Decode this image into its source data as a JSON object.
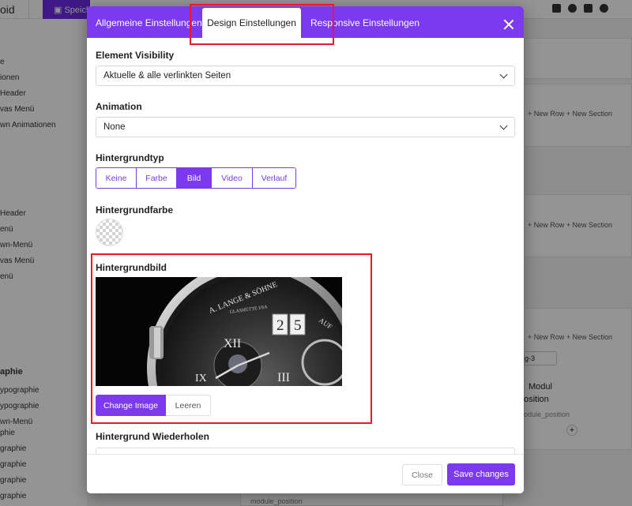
{
  "background": {
    "brand_fragment": "oid",
    "save_label": "Speichern",
    "sidebar_items": [
      "e",
      "ionen",
      "Header",
      "vas Menü",
      "wn Animationen",
      "Header",
      "enü",
      "wn-Menü",
      "vas Menü",
      "enü",
      "aphie",
      "ypographie",
      "ypographie",
      "wn-Menü",
      "phie",
      "graphie",
      "graphie",
      "graphie",
      "graphie"
    ],
    "row_control": "+ New Row  + New Section",
    "select_value": "g-3",
    "module_title": "Modul",
    "module_subtitle": "osition",
    "module_position": "odule_position",
    "bottom_text": "module_position",
    "plus": "+"
  },
  "modal": {
    "tabs": [
      "Allgemeine Einstellungen",
      "Design Einstellungen",
      "Responsive Einstellungen"
    ],
    "active_tab": "Design Einstellungen",
    "element_visibility": {
      "label": "Element Visibility",
      "value": "Aktuelle & alle verlinkten Seiten"
    },
    "animation": {
      "label": "Animation",
      "value": "None"
    },
    "background_type": {
      "label": "Hintergrundtyp",
      "options": [
        "Keine",
        "Farbe",
        "Bild",
        "Video",
        "Verlauf"
      ],
      "selected": "Bild"
    },
    "background_color": {
      "label": "Hintergrundfarbe",
      "value": "transparent"
    },
    "background_image": {
      "label": "Hintergrundbild",
      "watch_brand": "A. LANGE & SÖHNE",
      "watch_sub": "GLASHÜTTE I/SA",
      "watch_date_digits": [
        "2",
        "5"
      ],
      "watch_side": "AUF",
      "numerals": [
        "XII",
        "III",
        "IX"
      ],
      "change_label": "Change Image",
      "clear_label": "Leeren"
    },
    "background_repeat": {
      "label": "Hintergrund Wiederholen"
    },
    "footer": {
      "close_label": "Close",
      "save_label": "Save changes"
    }
  },
  "colors": {
    "accent": "#7b3aed",
    "highlight": "#e8192c",
    "overlay": "rgba(0,0,0,0.42)"
  }
}
